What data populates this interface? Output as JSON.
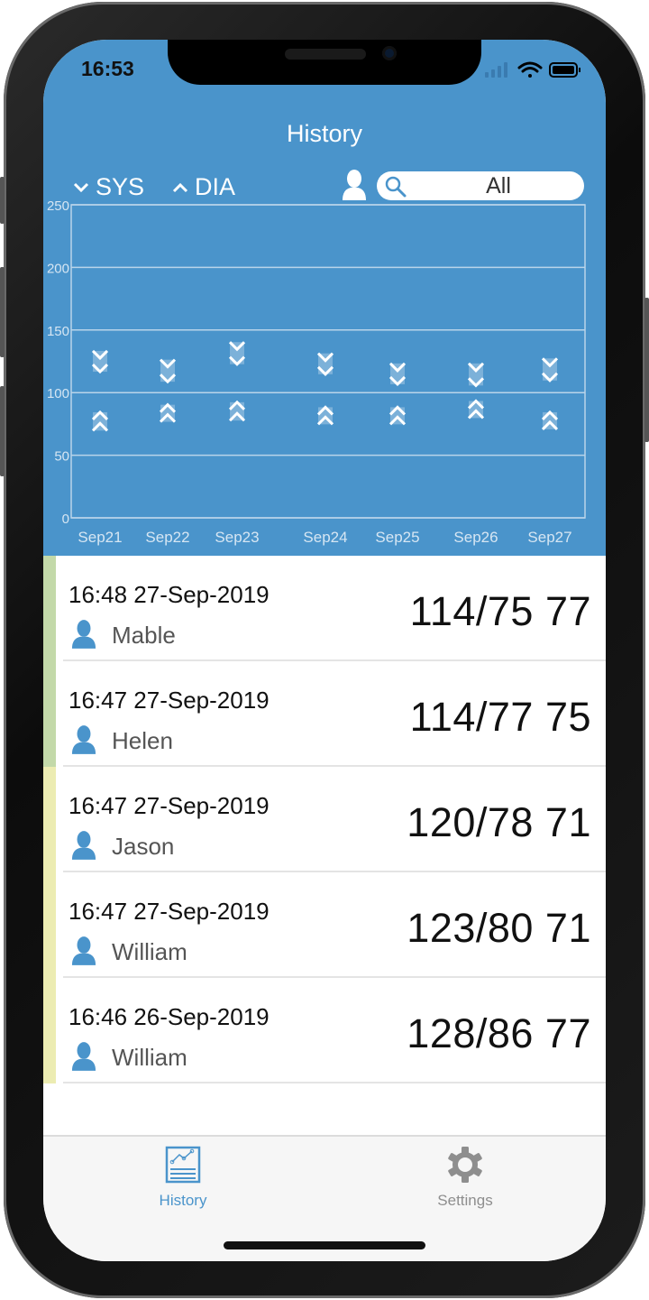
{
  "status_bar": {
    "time": "16:53",
    "icons": [
      "cellular-signal-icon",
      "wifi-icon",
      "battery-icon"
    ]
  },
  "header": {
    "title": "History"
  },
  "legend": {
    "sys_label": "SYS",
    "dia_label": "DIA",
    "sys_icon": "chevron-down-icon",
    "dia_icon": "chevron-up-icon"
  },
  "filter": {
    "user_icon": "person-icon",
    "search_icon": "search-icon",
    "value": "All"
  },
  "colors": {
    "header_blue": "#4a94cb",
    "stripe_green": "#c3d9a9",
    "stripe_yellow": "#ececb2",
    "icon_blue": "#4a94cb",
    "tab_active": "#4a94cb",
    "tab_inactive": "#8e8e8e"
  },
  "chart_data": {
    "type": "range",
    "title": "",
    "xlabel": "",
    "ylabel": "",
    "ylim": [
      0,
      250
    ],
    "yticks": [
      0,
      50,
      100,
      150,
      200,
      250
    ],
    "grid": true,
    "categories": [
      "Sep21",
      "Sep22",
      "Sep23",
      "Sep24",
      "Sep25",
      "Sep26",
      "Sep27"
    ],
    "series": [
      {
        "name": "SYS",
        "marker": "chevron-down",
        "min": [
          121,
          113,
          127,
          119,
          111,
          110,
          114
        ],
        "max": [
          129,
          122,
          136,
          127,
          119,
          119,
          123
        ]
      },
      {
        "name": "DIA",
        "marker": "chevron-up",
        "min": [
          74,
          81,
          82,
          79,
          79,
          84,
          75
        ],
        "max": [
          80,
          86,
          88,
          84,
          84,
          89,
          80
        ]
      }
    ]
  },
  "records": [
    {
      "datetime": "16:48 27-Sep-2019",
      "user": "Mable",
      "reading": "114/75 77",
      "stripe": "green"
    },
    {
      "datetime": "16:47 27-Sep-2019",
      "user": "Helen",
      "reading": "114/77 75",
      "stripe": "green"
    },
    {
      "datetime": "16:47 27-Sep-2019",
      "user": "Jason",
      "reading": "120/78 71",
      "stripe": "yellow"
    },
    {
      "datetime": "16:47 27-Sep-2019",
      "user": "William",
      "reading": "123/80 71",
      "stripe": "yellow"
    },
    {
      "datetime": "16:46 26-Sep-2019",
      "user": "William",
      "reading": "128/86 77",
      "stripe": "yellow"
    }
  ],
  "tabbar": {
    "tabs": [
      {
        "label": "History",
        "icon": "chart-document-icon",
        "active": true
      },
      {
        "label": "Settings",
        "icon": "gear-icon",
        "active": false
      }
    ]
  }
}
